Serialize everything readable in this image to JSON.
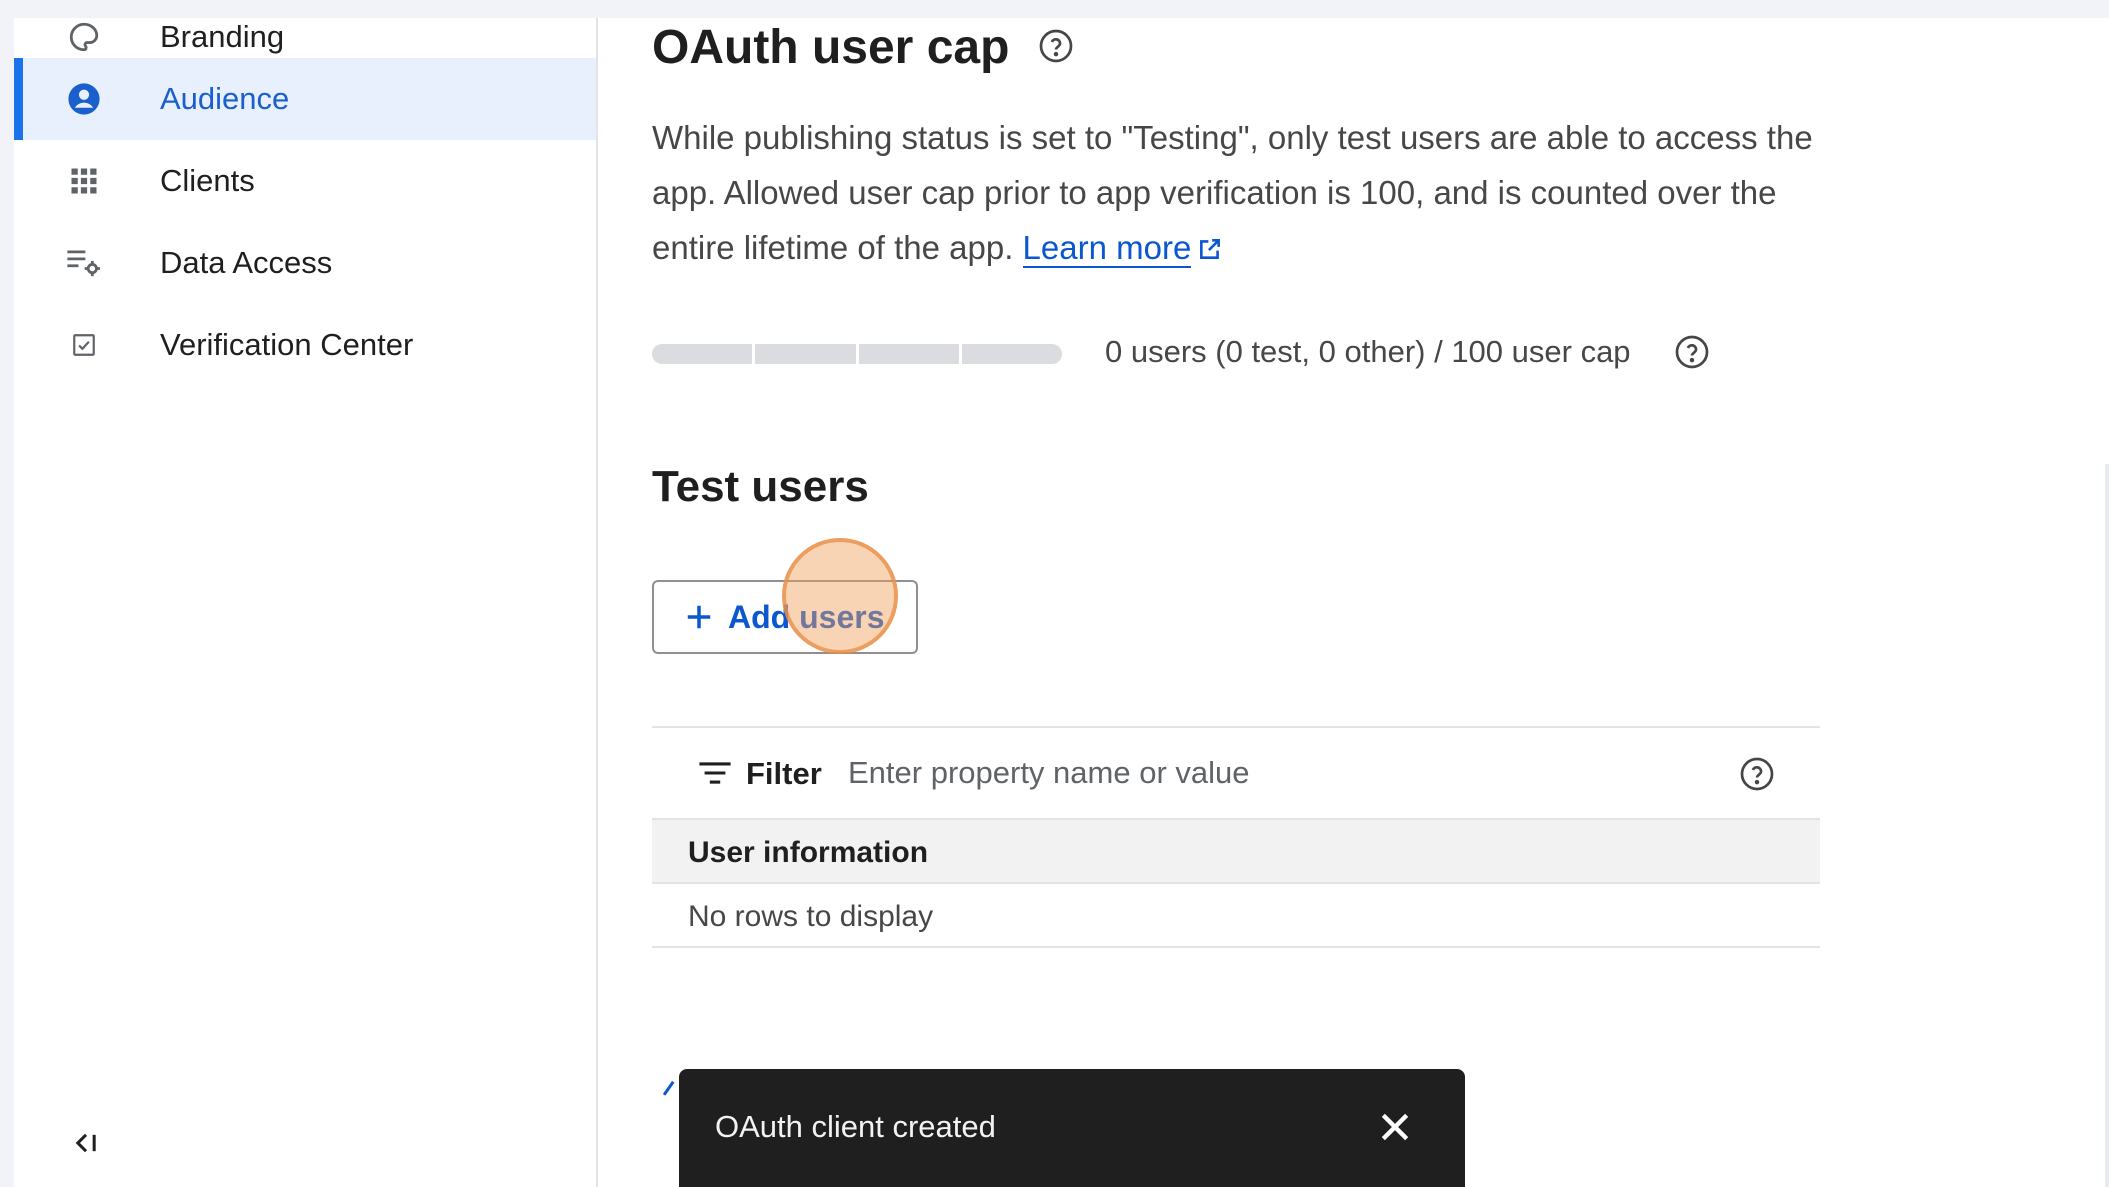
{
  "sidebar": {
    "items": [
      {
        "label": "Branding",
        "icon": "palette-icon",
        "active": false
      },
      {
        "label": "Audience",
        "icon": "account-circle-icon",
        "active": true
      },
      {
        "label": "Clients",
        "icon": "apps-grid-icon",
        "active": false
      },
      {
        "label": "Data Access",
        "icon": "data-settings-icon",
        "active": false
      },
      {
        "label": "Verification Center",
        "icon": "checkbox-icon",
        "active": false
      }
    ],
    "collapse_icon": "collapse-sidebar-icon"
  },
  "main": {
    "title": "OAuth user cap",
    "description_text": "While publishing status is set to \"Testing\", only test users are able to access the app. Allowed user cap prior to app verification is 100, and is counted over the entire lifetime of the app. ",
    "learn_more": "Learn more",
    "user_cap": {
      "text": "0 users (0 test, 0 other) / 100 user cap",
      "used": 0,
      "cap": 100
    },
    "test_users": {
      "title": "Test users",
      "add_button": "Add users",
      "filter_label": "Filter",
      "filter_placeholder": "Enter property name or value",
      "column_header": "User information",
      "empty_text": "No rows to display"
    }
  },
  "toast": {
    "message": "OAuth client created"
  },
  "colors": {
    "accent": "#0b57d0",
    "active_bg": "#e8effd",
    "toast_bg": "#1f1f1f"
  }
}
